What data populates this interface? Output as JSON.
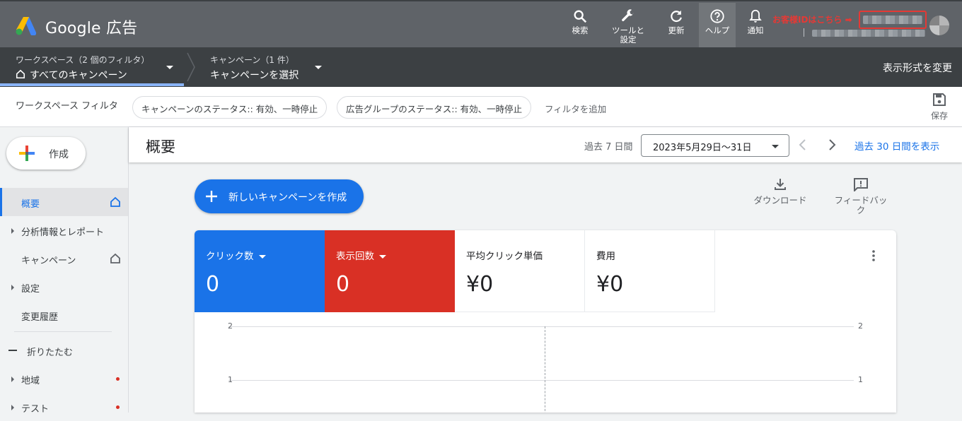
{
  "app": {
    "brand": "Google 広告"
  },
  "toolbar": {
    "search": "検索",
    "tools_line1": "ツールと",
    "tools_line2": "設定",
    "refresh": "更新",
    "help": "ヘルプ",
    "notifications": "通知"
  },
  "annotation": "お客様IDはこちら ➡",
  "nav": {
    "workspace_label": "ワークスペース（2 個のフィルタ）",
    "workspace_value": "すべてのキャンペーン",
    "campaign_label": "キャンペーン（1 件）",
    "campaign_value": "キャンペーンを選択",
    "view_change": "表示形式を変更"
  },
  "filters": {
    "label": "ワークスペース フィルタ",
    "chips": [
      "キャンペーンのステータス:: 有効、一時停止",
      "広告グループのステータス:: 有効、一時停止"
    ],
    "add": "フィルタを追加",
    "save": "保存"
  },
  "sidebar": {
    "create": "作成",
    "items": [
      "概要",
      "分析情報とレポート",
      "キャンペーン",
      "設定",
      "変更履歴"
    ],
    "collapse": "折りたたむ",
    "items2": [
      "地域",
      "テスト"
    ]
  },
  "header": {
    "title": "概要",
    "period": "過去 7 日間",
    "date_range": "2023年5月29日〜31日",
    "last30": "過去 30 日間を表示"
  },
  "actions": {
    "new_campaign": "新しいキャンペーンを作成",
    "download": "ダウンロード",
    "feedback_line1": "フィードバッ",
    "feedback_line2": "ク"
  },
  "metrics": [
    {
      "label": "クリック数",
      "value": "0"
    },
    {
      "label": "表示回数",
      "value": "0"
    },
    {
      "label": "平均クリック単価",
      "value": "¥0"
    },
    {
      "label": "費用",
      "value": "¥0"
    }
  ],
  "chart": {
    "ticks": [
      "2",
      "1"
    ]
  },
  "colors": {
    "accent": "#1a73e8",
    "clicks": "#1a73e8",
    "impressions": "#d93025",
    "annotation": "#e53935"
  }
}
